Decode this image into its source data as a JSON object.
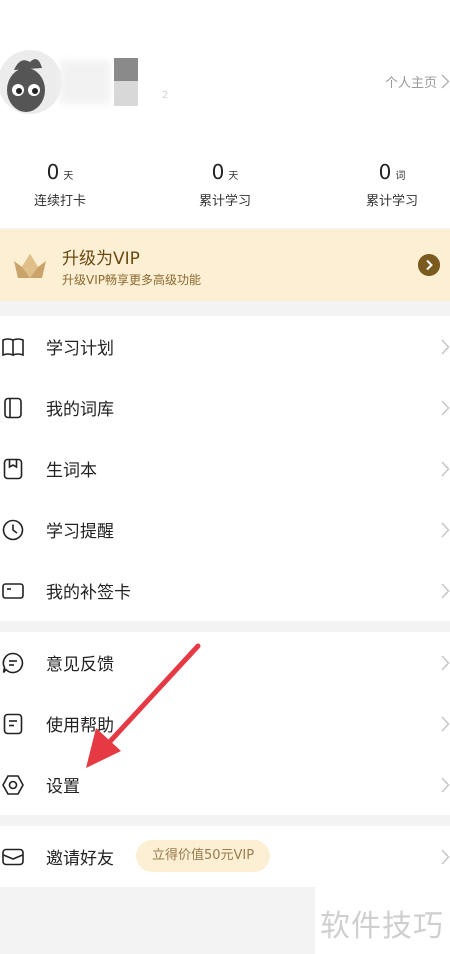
{
  "profile": {
    "small_text": "2",
    "home_link": "个人主页"
  },
  "stats": [
    {
      "value": "0",
      "unit": "天",
      "label": "连续打卡"
    },
    {
      "value": "0",
      "unit": "天",
      "label": "累计学习"
    },
    {
      "value": "0",
      "unit": "词",
      "label": "累计学习"
    }
  ],
  "vip": {
    "title": "升级为VIP",
    "subtitle": "升级VIP畅享更多高级功能"
  },
  "menu1": [
    {
      "label": "学习计划",
      "icon": "book-icon"
    },
    {
      "label": "我的词库",
      "icon": "wordbank-icon"
    },
    {
      "label": "生词本",
      "icon": "bookmark-icon"
    },
    {
      "label": "学习提醒",
      "icon": "clock-icon"
    },
    {
      "label": "我的补签卡",
      "icon": "card-icon"
    }
  ],
  "menu2": [
    {
      "label": "意见反馈",
      "icon": "chat-icon"
    },
    {
      "label": "使用帮助",
      "icon": "help-doc-icon"
    },
    {
      "label": "设置",
      "icon": "settings-icon"
    }
  ],
  "invite": {
    "label": "邀请好友",
    "badge": "立得价值50元VIP"
  },
  "watermark": "软件技巧",
  "colors": {
    "vip_bg": "#fcefd4",
    "vip_text": "#6b4a12",
    "annotation_arrow": "#e53a44"
  }
}
